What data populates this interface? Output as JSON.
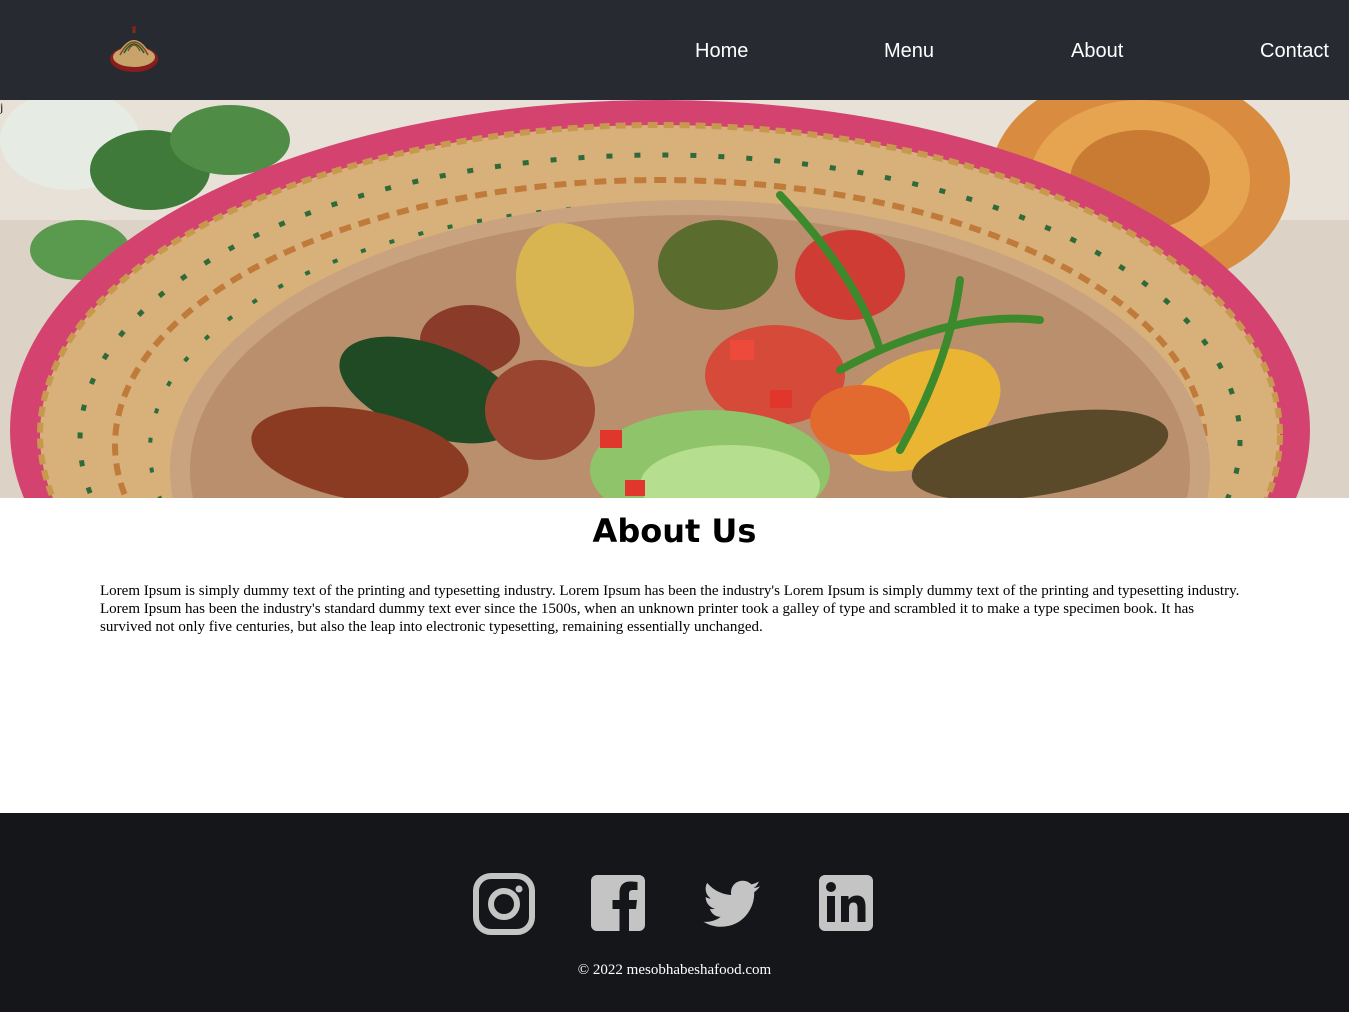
{
  "nav": {
    "logo_icon": "mesob-basket-icon",
    "links": [
      {
        "label": "Home"
      },
      {
        "label": "Menu"
      },
      {
        "label": "About"
      },
      {
        "label": "Contact"
      }
    ]
  },
  "hero": {
    "image_subject": "injera platter in woven mesob basket",
    "alt_text": "j"
  },
  "about": {
    "title": "About Us",
    "body": "Lorem Ipsum is simply dummy text of the printing and typesetting industry. Lorem Ipsum has been the industry's Lorem Ipsum is simply dummy text of the printing and typesetting industry. Lorem Ipsum has been the industry's standard dummy text ever since the 1500s, when an unknown printer took a galley of type and scrambled it to make a type specimen book. It has survived not only five centuries, but also the leap into electronic typesetting, remaining essentially unchanged."
  },
  "footer": {
    "social_icons": [
      "instagram-icon",
      "facebook-icon",
      "twitter-icon",
      "linkedin-icon"
    ],
    "copyright": "© 2022 mesobhabeshafood.com"
  },
  "colors": {
    "nav_bg": "#272a31",
    "footer_bg": "#141619",
    "icon_gray": "#c4c4c4",
    "basket_pink": "#d9436a"
  }
}
